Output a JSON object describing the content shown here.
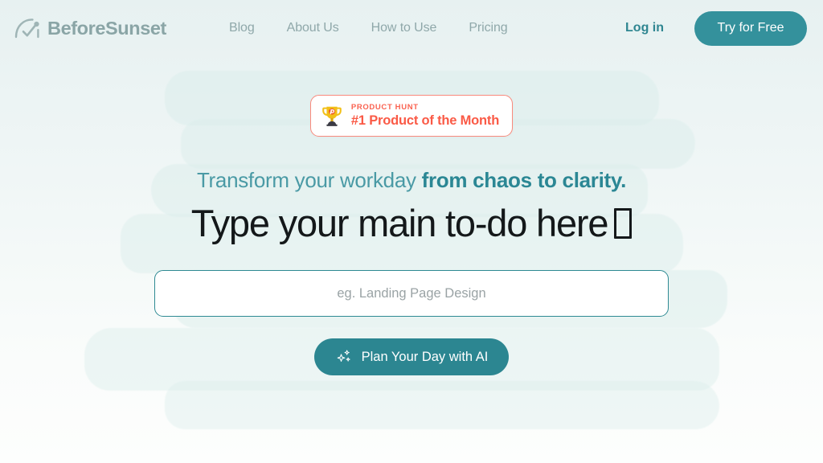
{
  "brand": {
    "name": "BeforeSunset",
    "logo_icon": "sunset-arc-check-icon"
  },
  "header": {
    "nav_items": [
      {
        "label": "Blog",
        "name": "nav-link-blog"
      },
      {
        "label": "About Us",
        "name": "nav-link-about-us"
      },
      {
        "label": "How to Use",
        "name": "nav-link-how-to-use"
      },
      {
        "label": "Pricing",
        "name": "nav-link-pricing"
      }
    ],
    "login_label": "Log in",
    "cta_label": "Try for Free"
  },
  "badge": {
    "icon": "trophy-icon",
    "kicker": "PRODUCT HUNT",
    "title": "#1 Product of the Month"
  },
  "hero": {
    "subhead_light": "Transform your workday",
    "subhead_bold": "from chaos to clarity.",
    "headline": "Type your main to-do here",
    "headline_trailing_glyph": "missing-glyph-box",
    "input_placeholder": "eg. Landing Page Design",
    "input_value": "",
    "plan_button_label": "Plan Your Day with AI",
    "plan_button_icon": "sparkles-icon"
  },
  "colors": {
    "page_top": "#e7f1f1",
    "page_bottom": "#fdfefd",
    "blob": "#dceeec",
    "teal_primary": "#2c8691",
    "teal_accent": "#34919c",
    "teal_subhead": "#4a9aa5",
    "teal_subhead_bold": "#2b8794",
    "logo_gray": "#8aa5a6",
    "nav_gray": "#8fa8aa",
    "badge_red": "#fa5a46",
    "badge_border": "#f98a7d",
    "headline_black": "#14181a",
    "input_border": "#2f8a93",
    "placeholder_gray": "#9aa3a5"
  }
}
